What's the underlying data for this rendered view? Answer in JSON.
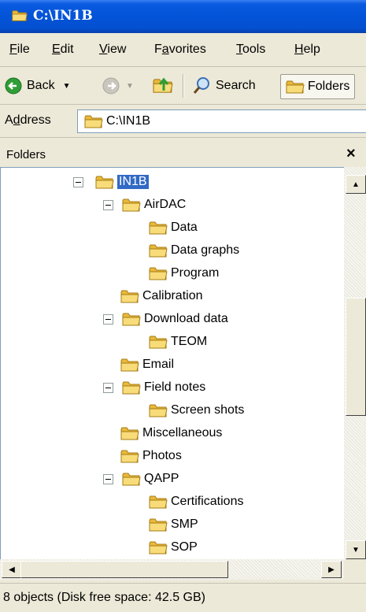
{
  "window": {
    "title": "C:\\IN1B"
  },
  "menu": [
    {
      "label": "File",
      "u": "F",
      "rest": "ile"
    },
    {
      "label": "Edit",
      "u": "E",
      "rest": "dit"
    },
    {
      "label": "View",
      "u": "V",
      "rest": "iew"
    },
    {
      "label": "Favorites",
      "pre": "F",
      "u": "a",
      "rest": "vorites"
    },
    {
      "label": "Tools",
      "u": "T",
      "rest": "ools"
    },
    {
      "label": "Help",
      "u": "H",
      "rest": "elp"
    }
  ],
  "toolbar": {
    "back_label": "Back",
    "search_label": "Search",
    "folders_label": "Folders"
  },
  "address": {
    "label_pre": "A",
    "label_u": "d",
    "label_rest": "dress",
    "value": "C:\\IN1B"
  },
  "pane": {
    "title": "Folders",
    "close": "×"
  },
  "tree": {
    "items": [
      {
        "label": "IN1B",
        "selected": true
      },
      {
        "label": "AirDAC"
      },
      {
        "label": "Data"
      },
      {
        "label": "Data graphs"
      },
      {
        "label": "Program"
      },
      {
        "label": "Calibration"
      },
      {
        "label": "Download data"
      },
      {
        "label": "TEOM"
      },
      {
        "label": "Email"
      },
      {
        "label": "Field notes"
      },
      {
        "label": "Screen shots"
      },
      {
        "label": "Miscellaneous"
      },
      {
        "label": "Photos"
      },
      {
        "label": "QAPP"
      },
      {
        "label": "Certifications"
      },
      {
        "label": "SMP"
      },
      {
        "label": "SOP"
      }
    ]
  },
  "status": {
    "text": "8 objects (Disk free space: 42.5 GB)"
  },
  "colors": {
    "title_blue": "#0454d8",
    "selection": "#316ac5",
    "folder": "#f5d66b"
  },
  "icons": {
    "folder": "folder-icon",
    "back": "back-arrow-icon",
    "up": "up-folder-icon",
    "search": "search-icon"
  }
}
